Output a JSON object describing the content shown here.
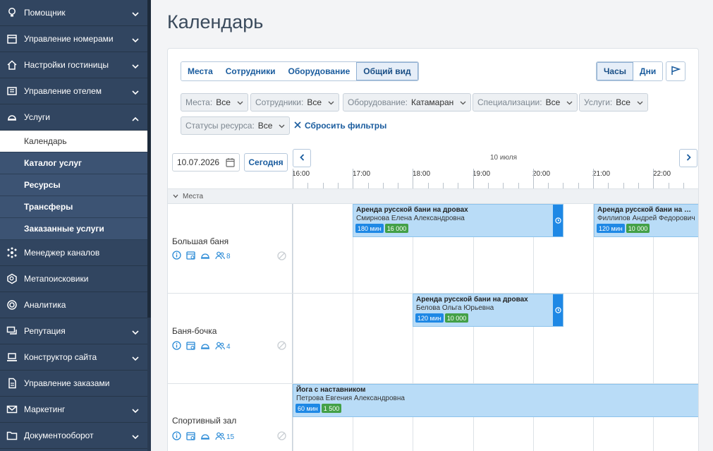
{
  "sidebar": {
    "items": [
      {
        "label": "Помощник",
        "icon": "bulb-icon",
        "chevron": "down"
      },
      {
        "label": "Управление номерами",
        "icon": "calendar-icon",
        "chevron": "down"
      },
      {
        "label": "Настройки гостиницы",
        "icon": "house-icon",
        "chevron": "down"
      },
      {
        "label": "Управление отелем",
        "icon": "dashboard-icon",
        "chevron": "down"
      },
      {
        "label": "Услуги",
        "icon": "bell-icon",
        "chevron": "up"
      }
    ],
    "sub_items": [
      {
        "label": "Календарь",
        "active": true
      },
      {
        "label": "Каталог услуг",
        "active": false
      },
      {
        "label": "Ресурсы",
        "active": false
      },
      {
        "label": "Трансферы",
        "active": false
      },
      {
        "label": "Заказанные услуги",
        "active": false
      }
    ],
    "items_after": [
      {
        "label": "Менеджер каналов",
        "icon": "network-icon",
        "chevron": ""
      },
      {
        "label": "Метапоисковики",
        "icon": "search-badge-icon",
        "chevron": ""
      },
      {
        "label": "Аналитика",
        "icon": "target-icon",
        "chevron": ""
      },
      {
        "label": "Репутация",
        "icon": "chat-icon",
        "chevron": "down"
      },
      {
        "label": "Конструктор сайта",
        "icon": "laptop-icon",
        "chevron": "down"
      },
      {
        "label": "Управление заказами",
        "icon": "document-icon",
        "chevron": ""
      },
      {
        "label": "Маркетинг",
        "icon": "mail-icon",
        "chevron": "down"
      },
      {
        "label": "Документооборот",
        "icon": "folder-icon",
        "chevron": "down"
      }
    ]
  },
  "page": {
    "title": "Календарь"
  },
  "view_tabs": [
    "Места",
    "Сотрудники",
    "Оборудование",
    "Общий вид"
  ],
  "active_view_tab": "Общий вид",
  "scale_tabs": [
    "Часы",
    "Дни"
  ],
  "active_scale_tab": "Часы",
  "filters": [
    {
      "label": "Места:",
      "value": "Все"
    },
    {
      "label": "Сотрудники:",
      "value": "Все"
    },
    {
      "label": "Оборудование:",
      "value": "Катамаран"
    },
    {
      "label": "Специализации:",
      "value": "Все"
    },
    {
      "label": "Услуги:",
      "value": "Все"
    },
    {
      "label": "Статусы ресурса:",
      "value": "Все"
    }
  ],
  "reset_filters": "Сбросить фильтры",
  "date_value": "10.07.2026",
  "today_button": "Сегодня",
  "day_label": "10 июля",
  "hours": [
    "16:00",
    "17:00",
    "18:00",
    "19:00",
    "20:00",
    "21:00",
    "22:00"
  ],
  "section_label": "Места",
  "resources": [
    {
      "name": "Большая баня",
      "count": "8"
    },
    {
      "name": "Баня-бочка",
      "count": "4"
    },
    {
      "name": "Спортивный зал",
      "count": "15"
    }
  ],
  "events": [
    {
      "title": "Аренда русской бани на дровах",
      "person": "Смирнова Елена Александровна",
      "duration": "180 мин",
      "price": "16 000",
      "start": "17:00",
      "end": "20:30",
      "row": 0,
      "has_side": true
    },
    {
      "title": "Аренда русской бани на дровах",
      "person": "Филлипов Андрей Федорович",
      "duration": "120 мин",
      "price": "10 000",
      "start": "21:00",
      "end": "23:00",
      "row": 0,
      "has_side": false
    },
    {
      "title": "Аренда русской бани на дровах",
      "person": "Белова Ольга Юрьевна",
      "duration": "120 мин",
      "price": "10 000",
      "start": "18:00",
      "end": "20:30",
      "row": 1,
      "has_side": true
    },
    {
      "title": "Йога с наставником",
      "person": "Петрова Евгения Александровна",
      "duration": "60 мин",
      "price": "1 500",
      "start": "16:00",
      "end": "23:00",
      "row": 2,
      "has_side": false
    }
  ],
  "colors": {
    "sidebar": "#314560",
    "accent": "#1a5c9e",
    "event": "#b9dcf7",
    "duration_badge": "#1e88e5",
    "price_badge": "#43a047"
  }
}
